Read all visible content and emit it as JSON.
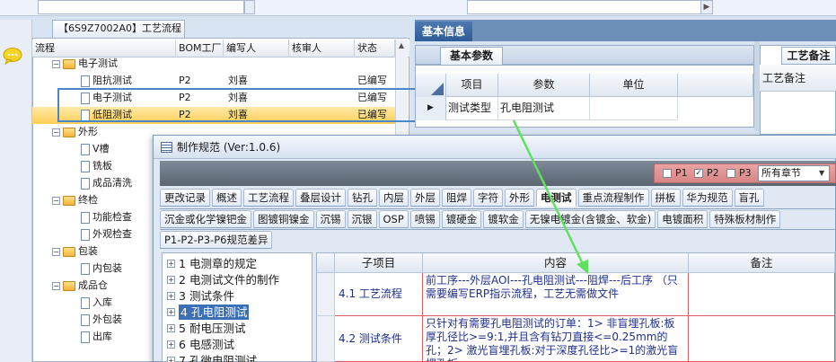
{
  "tree_tab": {
    "title": "【6S9Z7002A0】工艺流程"
  },
  "tree": {
    "columns": [
      "流程",
      "BOM工厂",
      "编写人",
      "核审人",
      "状态"
    ],
    "rows": [
      {
        "name": "电子测试",
        "kind": "folder",
        "indent": 1,
        "bom": "",
        "writer": "",
        "status": ""
      },
      {
        "name": "阻抗测试",
        "kind": "doc",
        "indent": 2,
        "bom": "P2",
        "writer": "刘喜",
        "status": "已编写"
      },
      {
        "name": "电子测试",
        "kind": "doc",
        "indent": 2,
        "bom": "P2",
        "writer": "刘喜",
        "status": "已编写"
      },
      {
        "name": "低阻测试",
        "kind": "doc",
        "indent": 2,
        "bom": "P2",
        "writer": "刘喜",
        "status": "已编写"
      },
      {
        "name": "外形",
        "kind": "folder",
        "indent": 1,
        "bom": "",
        "writer": "",
        "status": ""
      },
      {
        "name": "V槽",
        "kind": "doc",
        "indent": 2,
        "bom": "",
        "writer": "",
        "status": ""
      },
      {
        "name": "铣板",
        "kind": "doc",
        "indent": 2,
        "bom": "",
        "writer": "",
        "status": ""
      },
      {
        "name": "成品清洗",
        "kind": "doc",
        "indent": 2,
        "bom": "",
        "writer": "",
        "status": ""
      },
      {
        "name": "终检",
        "kind": "folder",
        "indent": 1,
        "bom": "",
        "writer": "",
        "status": ""
      },
      {
        "name": "功能检查",
        "kind": "doc",
        "indent": 2,
        "bom": "",
        "writer": "",
        "status": ""
      },
      {
        "name": "外观检查",
        "kind": "doc",
        "indent": 2,
        "bom": "",
        "writer": "",
        "status": ""
      },
      {
        "name": "包装",
        "kind": "folder",
        "indent": 1,
        "bom": "",
        "writer": "",
        "status": ""
      },
      {
        "name": "内包装",
        "kind": "doc",
        "indent": 2,
        "bom": "",
        "writer": "",
        "status": ""
      },
      {
        "name": "成品仓",
        "kind": "folder",
        "indent": 1,
        "bom": "",
        "writer": "",
        "status": ""
      },
      {
        "name": "入库",
        "kind": "doc",
        "indent": 2,
        "bom": "",
        "writer": "",
        "status": ""
      },
      {
        "name": "外包装",
        "kind": "doc",
        "indent": 2,
        "bom": "",
        "writer": "",
        "status": ""
      },
      {
        "name": "出库",
        "kind": "doc",
        "indent": 2,
        "bom": "",
        "writer": "",
        "status": ""
      }
    ],
    "selected_index": 3
  },
  "info": {
    "title": "基本信息",
    "basic_tab": "基本参数",
    "param_headers": [
      "项目",
      "参数",
      "单位"
    ],
    "param_row": {
      "item": "测试类型",
      "value": "孔电阻测试",
      "unit": ""
    },
    "remark_tab": "工艺备注",
    "remark_header": "工艺备注"
  },
  "dialog": {
    "title": "制作规范 (Ver:1.0.6)",
    "filters": [
      {
        "label": "P1",
        "checked": false
      },
      {
        "label": "P2",
        "checked": true
      },
      {
        "label": "P3",
        "checked": false
      }
    ],
    "chapter_select": "所有章节",
    "tabs_row1": [
      "更改记录",
      "概述",
      "工艺流程",
      "叠层设计",
      "钻孔",
      "内层",
      "外层",
      "阻焊",
      "字符",
      "外形",
      "电测试",
      "重点流程制作",
      "拼板",
      "华为规范",
      "盲孔"
    ],
    "tabs_row1_active": 10,
    "tabs_row2": [
      "沉金或化学镍钯金",
      "图镀铜镍金",
      "沉锡",
      "沉银",
      "OSP",
      "喷锡",
      "镀硬金",
      "镀软金",
      "无镍电镀金(含镀金、软金)",
      "电镀面积",
      "特殊板材制作"
    ],
    "tabs_row3": [
      "P1-P2-P3-P6规范差异"
    ],
    "chapters": [
      {
        "num": "1",
        "text": "电测章的规定"
      },
      {
        "num": "2",
        "text": "电测试文件的制作"
      },
      {
        "num": "3",
        "text": "测试条件"
      },
      {
        "num": "4",
        "text": "孔电阻测试"
      },
      {
        "num": "5",
        "text": "耐电压测试"
      },
      {
        "num": "6",
        "text": "电感测试"
      },
      {
        "num": "7",
        "text": "孔微电阻测试"
      }
    ],
    "selected_chapter": 3,
    "grid_headers": [
      "子项目",
      "内容",
      "备注"
    ],
    "grid_rows": [
      {
        "sub": "4.1 工艺流程",
        "content": "前工序---外层AOI---孔电阻测试---阻焊---后工序 （只需要编写ERP指示流程，工艺无需做文件",
        "remark": ""
      },
      {
        "sub": "4.2 测试条件",
        "content": "只针对有需要孔电阻测试的订单：1> 非盲埋孔板:板厚孔径比>=9:1,并且含有钻刀直接<=0.25mm的孔；2> 激光盲埋孔板:对于深度孔径比>=1的激光盲埋孔板",
        "remark": ""
      }
    ]
  }
}
